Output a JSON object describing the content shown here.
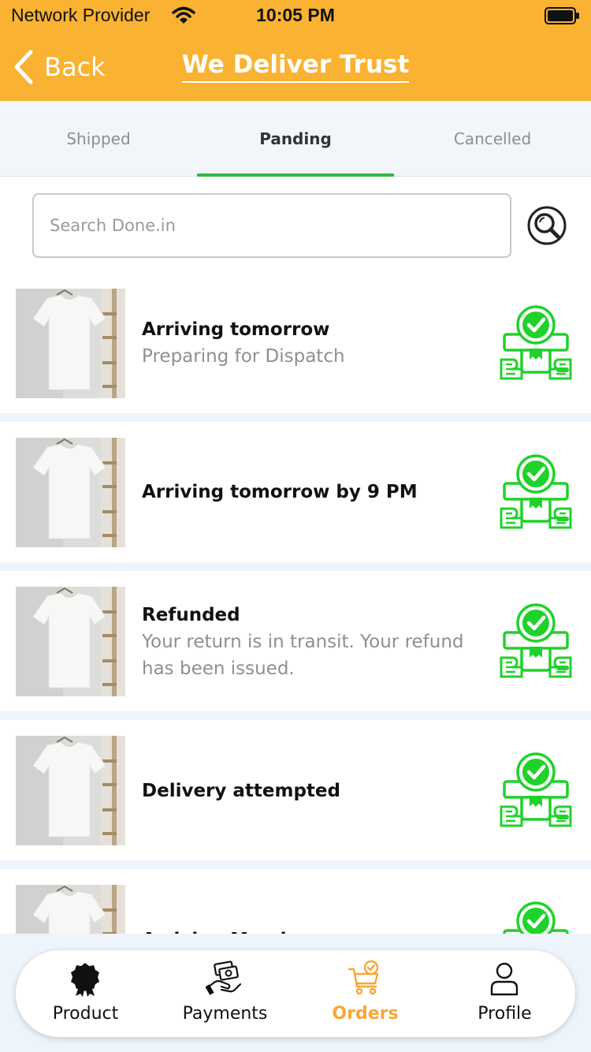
{
  "status_bar": {
    "carrier": "Network Provider",
    "time": "10:05 PM"
  },
  "nav": {
    "back_label": "Back",
    "title": "We Deliver Trust"
  },
  "tabs": [
    {
      "label": "Shipped",
      "active": false
    },
    {
      "label": "Panding",
      "active": true
    },
    {
      "label": "Cancelled",
      "active": false
    }
  ],
  "search": {
    "placeholder": "Search Done.in",
    "value": ""
  },
  "orders": [
    {
      "title": "Arriving tomorrow",
      "subtitle": "Preparing for Dispatch"
    },
    {
      "title": "Arriving tomorrow by 9 PM",
      "subtitle": ""
    },
    {
      "title": "Refunded",
      "subtitle": "Your return is in transit. Your refund has been issued."
    },
    {
      "title": "Delivery attempted",
      "subtitle": ""
    },
    {
      "title": "Arriving Monday",
      "subtitle": ""
    }
  ],
  "bottom_nav": [
    {
      "label": "Product",
      "icon": "badge-icon",
      "active": false
    },
    {
      "label": "Payments",
      "icon": "hand-money-icon",
      "active": false
    },
    {
      "label": "Orders",
      "icon": "cart-check-icon",
      "active": true
    },
    {
      "label": "Profile",
      "icon": "user-icon",
      "active": false
    }
  ],
  "colors": {
    "header": "#f9b232",
    "accent_green": "#2fba45",
    "active_orange": "#f9a633"
  }
}
